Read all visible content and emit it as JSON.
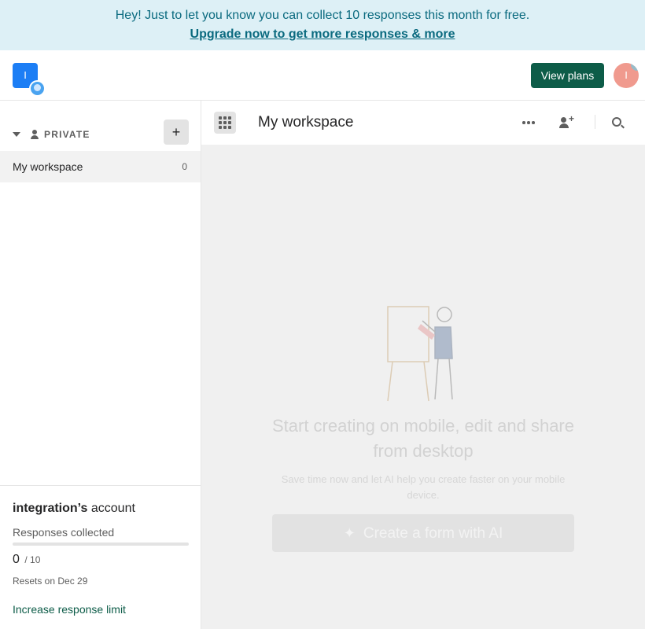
{
  "banner": {
    "message": "Hey! Just to let you know you can collect 10 responses this month for free.",
    "upgrade_link": "Upgrade now to get more responses & more"
  },
  "topbar": {
    "logo_letter": "I",
    "view_plans_label": "View plans",
    "avatar_letter": "I"
  },
  "sidebar": {
    "section_label": "PRIVATE",
    "add_label": "+",
    "workspaces": [
      {
        "name": "My workspace",
        "count": "0"
      }
    ],
    "account": {
      "owner": "integration’s",
      "suffix": " account",
      "responses_label": "Responses collected",
      "responses_collected": "0",
      "responses_limit": "/ 10",
      "progress_fraction": 0,
      "resets": "Resets on Dec 29",
      "increase_link": "Increase response limit"
    }
  },
  "main": {
    "title": "My workspace",
    "empty_state": {
      "title": "Start creating on mobile, edit and share from desktop",
      "subtitle": "Save time now and let AI help you create faster on your mobile device.",
      "button_label": "Create a form with AI"
    }
  },
  "colors": {
    "banner_bg": "#ddf0f6",
    "banner_text": "#0a6a7f",
    "primary": "#0d5c48",
    "logo": "#1c7ef5",
    "avatar": "#f09a8e"
  }
}
